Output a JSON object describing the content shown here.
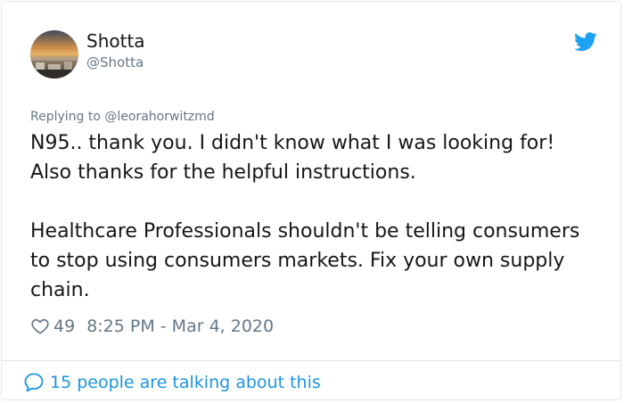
{
  "user": {
    "display_name": "Shotta",
    "handle": "@Shotta"
  },
  "reply": {
    "text": "Replying to @leorahorwitzmd"
  },
  "tweet": {
    "paragraphs": [
      "N95.. thank you. I didn't know what I was looking for! Also thanks for the helpful instructions.",
      "Healthcare Professionals shouldn't be telling consumers to stop using consumers markets. Fix your own supply chain."
    ]
  },
  "meta": {
    "likes": "49",
    "timestamp": "8:25 PM - Mar 4, 2020"
  },
  "conversation": {
    "label": "15 people are talking about this"
  },
  "icons": {
    "brand": "twitter-bird-icon",
    "like": "heart-icon",
    "conversation": "speech-bubble-icon"
  },
  "colors": {
    "twitter_blue": "#1da1f2",
    "link_blue": "#1b95e0",
    "secondary_text": "#657786",
    "primary_text": "#14171a",
    "border": "#e1e8ed"
  }
}
